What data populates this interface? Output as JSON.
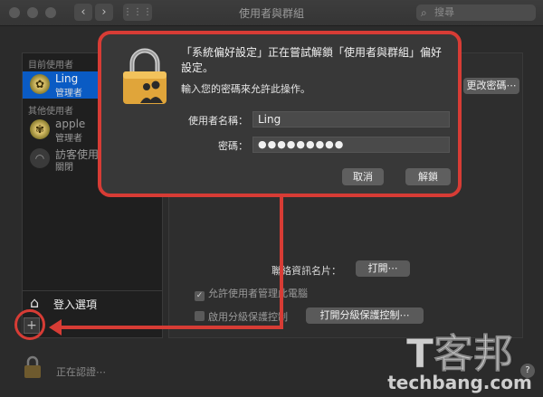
{
  "window": {
    "title": "使用者與群組",
    "search_placeholder": "搜尋",
    "back_glyph": "‹",
    "forward_glyph": "›",
    "grid_glyph": "⋮⋮⋮"
  },
  "sidebar": {
    "current_users_header": "目前使用者",
    "other_users_header": "其他使用者",
    "current_user": {
      "name": "Ling",
      "role": "管理者"
    },
    "other_users": [
      {
        "name": "apple",
        "role": "管理者"
      },
      {
        "name": "訪客使用者",
        "role": "關閉"
      }
    ],
    "login_options_label": "登入選項",
    "add_button_label": "+"
  },
  "main": {
    "change_password_label": "更改密碼⋯",
    "contact_card_label": "聯絡資訊名片：",
    "open_button_label": "打開⋯",
    "allow_admin_label": "允許使用者管理此電腦",
    "parental_controls_label": "啟用分級保護控制",
    "open_parental_button_label": "打開分級保護控制⋯"
  },
  "footer": {
    "status_text": "正在認證⋯",
    "help_label": "?"
  },
  "dialog": {
    "message": "「系統偏好設定」正在嘗試解鎖「使用者與群組」偏好設定。",
    "prompt": "輸入您的密碼來允許此操作。",
    "username_label": "使用者名稱：",
    "username_value": "Ling",
    "password_label": "密碼：",
    "password_value": "●●●●●●●●●",
    "cancel_label": "取消",
    "unlock_label": "解鎖"
  },
  "watermark": {
    "brand_glyph": "T客邦",
    "site": "techbang.com"
  },
  "colors": {
    "highlight_red": "#d73c35",
    "selection_blue": "#0a5bc4",
    "window_bg": "#2b2b2b"
  }
}
